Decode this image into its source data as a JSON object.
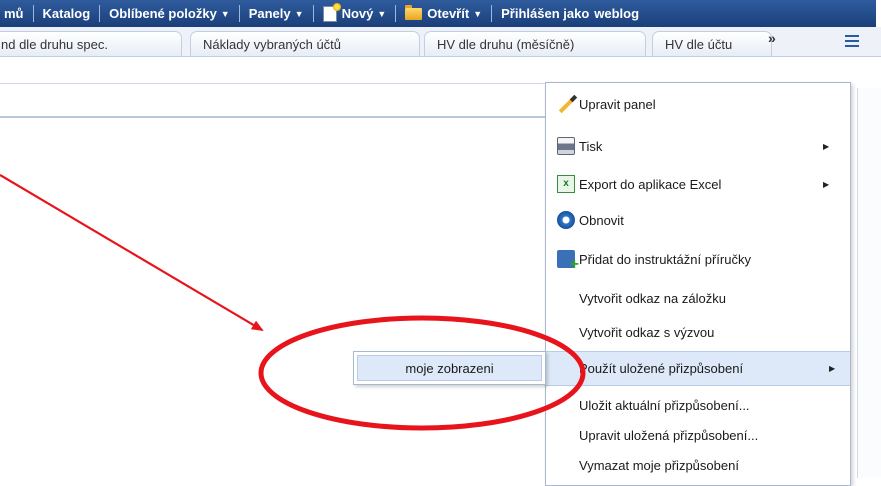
{
  "topbar": {
    "items": [
      {
        "label": "mů",
        "caret": false
      },
      {
        "label": "Katalog",
        "caret": false
      },
      {
        "label": "Oblíbené položky",
        "caret": true
      },
      {
        "label": "Panely",
        "caret": true
      },
      {
        "label": "Nový",
        "caret": true,
        "icon": "new-document-icon"
      },
      {
        "label": "Otevřít",
        "caret": true,
        "icon": "folder-icon"
      }
    ],
    "login_label": "Přihlášen jako",
    "login_user": "weblog",
    "caret_glyph": "▼"
  },
  "tabs": {
    "items": [
      {
        "label": "nd dle druhu spec."
      },
      {
        "label": "Náklady vybraných účtů"
      },
      {
        "label": "HV dle druhu (měsíčně)"
      },
      {
        "label": "HV dle účtu"
      }
    ],
    "overflow_glyph": "»",
    "options_icon": "page-options-icon"
  },
  "menu": {
    "items": [
      {
        "label": "Upravit panel",
        "icon": "pencil-icon",
        "submenu": false
      },
      {
        "label": "Tisk",
        "icon": "printer-icon",
        "submenu": true
      },
      {
        "label": "Export do aplikace Excel",
        "icon": "excel-icon",
        "submenu": true
      },
      {
        "label": "Obnovit",
        "icon": "refresh-icon",
        "submenu": false
      },
      {
        "label": "Přidat do instruktážní příručky",
        "icon": "add-to-guide-icon",
        "submenu": false
      },
      {
        "label": "Vytvořit odkaz na záložku",
        "icon": "",
        "submenu": false
      },
      {
        "label": "Vytvořit odkaz s výzvou",
        "icon": "",
        "submenu": false
      },
      {
        "label": "Použít uložené přizpůsobení",
        "icon": "",
        "submenu": true,
        "active": true
      },
      {
        "label": "Uložit aktuální přizpůsobení...",
        "icon": "",
        "submenu": false
      },
      {
        "label": "Upravit uložená přizpůsobení...",
        "icon": "",
        "submenu": false
      },
      {
        "label": "Vymazat moje přizpůsobení",
        "icon": "",
        "submenu": false
      }
    ],
    "arrow_glyph": "▶"
  },
  "submenu": {
    "items": [
      {
        "label": "moje zobrazeni"
      }
    ]
  },
  "colors": {
    "topbar": "#1f4a8a",
    "menu_highlight": "#dde9f8",
    "annotation_red": "#e8141c"
  }
}
